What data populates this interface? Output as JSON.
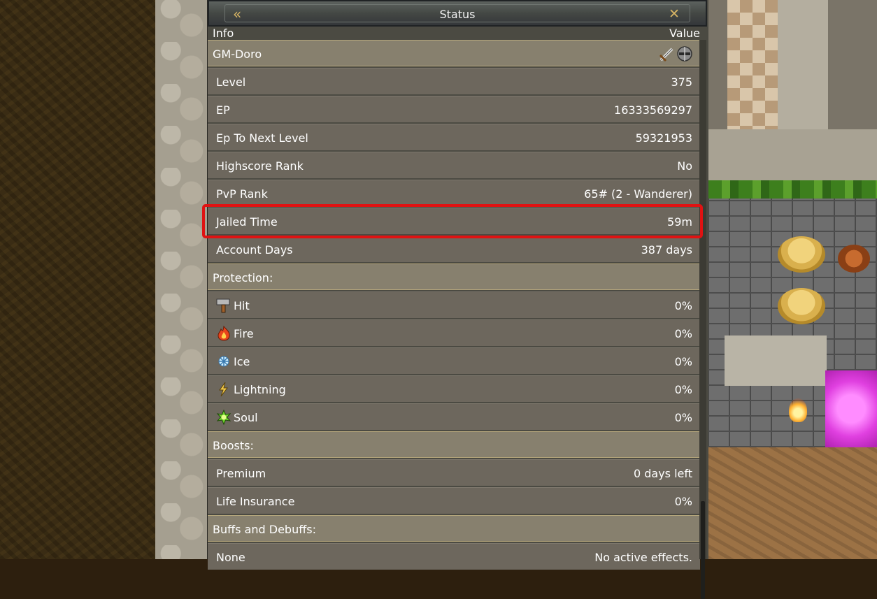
{
  "window": {
    "title": "Status",
    "back_icon": "double-chevron-left-icon",
    "close_icon": "close-icon"
  },
  "columns": {
    "info": "Info",
    "value": "Value"
  },
  "player": {
    "name": "GM-Doro",
    "icons": [
      "sword-icon",
      "helmet-icon"
    ]
  },
  "stats": [
    {
      "label": "Level",
      "value": "375"
    },
    {
      "label": "EP",
      "value": "16333569297"
    },
    {
      "label": "Ep To Next Level",
      "value": "59321953"
    },
    {
      "label": "Highscore Rank",
      "value": "No"
    },
    {
      "label": "PvP Rank",
      "value": "65# (2 - Wanderer)"
    },
    {
      "label": "Jailed Time",
      "value": "59m"
    },
    {
      "label": "Account Days",
      "value": "387 days"
    }
  ],
  "protection": {
    "heading": "Protection:",
    "items": [
      {
        "label": "Hit",
        "value": "0%",
        "icon": "hammer-icon"
      },
      {
        "label": "Fire",
        "value": "0%",
        "icon": "fire-icon"
      },
      {
        "label": "Ice",
        "value": "0%",
        "icon": "snowflake-icon"
      },
      {
        "label": "Lightning",
        "value": "0%",
        "icon": "lightning-icon"
      },
      {
        "label": "Soul",
        "value": "0%",
        "icon": "soul-icon"
      }
    ]
  },
  "boosts": {
    "heading": "Boosts:",
    "items": [
      {
        "label": "Premium",
        "value": "0 days left"
      },
      {
        "label": "Life Insurance",
        "value": "0%"
      }
    ]
  },
  "buffs": {
    "heading": "Buffs and Debuffs:",
    "items": [
      {
        "label": "None",
        "value": "No active effects."
      }
    ]
  },
  "colors": {
    "highlight": "#e01212",
    "accent": "#d7b464"
  }
}
